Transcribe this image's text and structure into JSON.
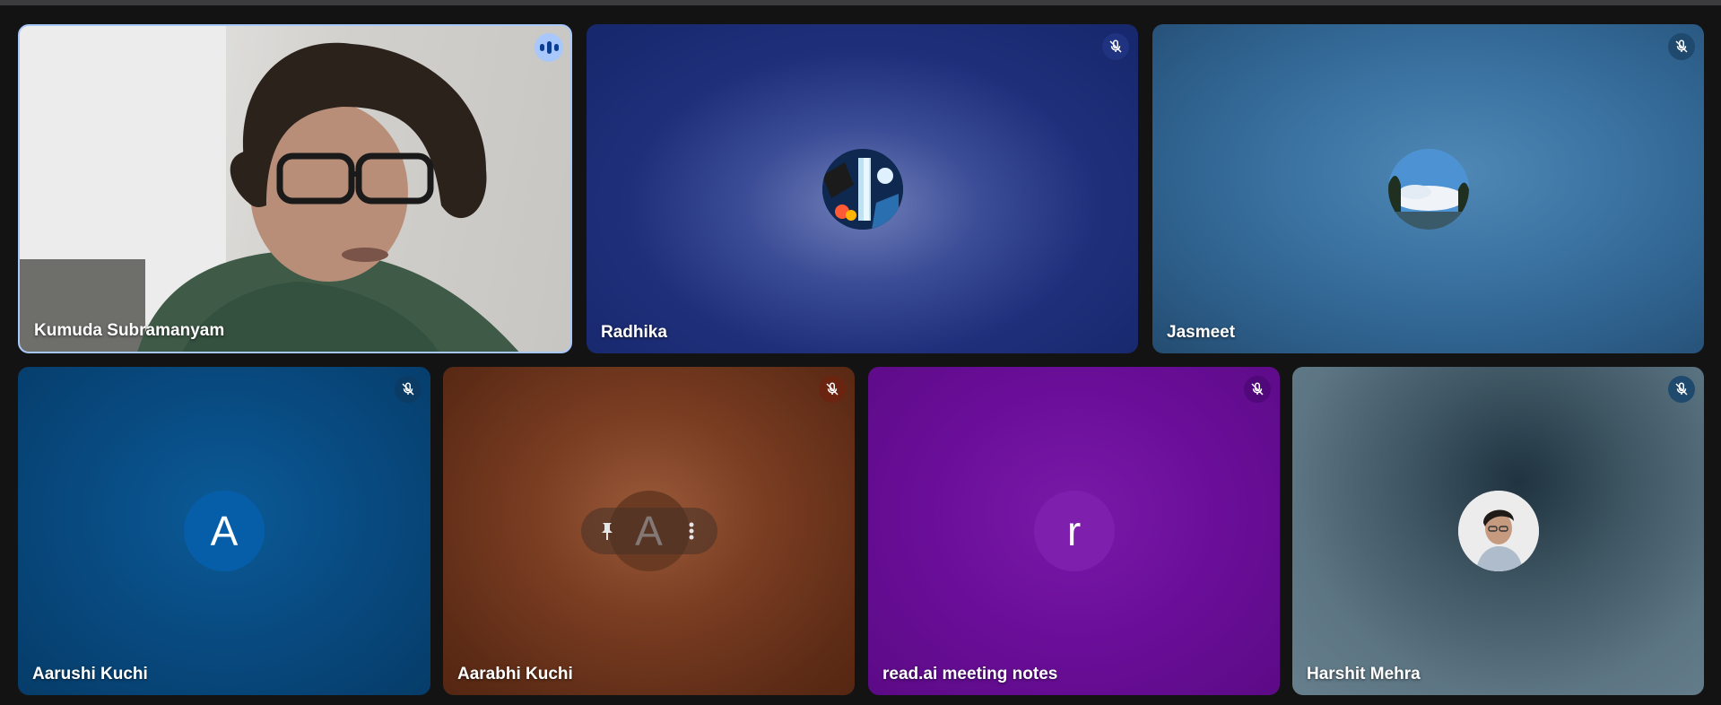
{
  "participants": [
    {
      "name": "Kumuda Subramanyam",
      "state": "speaking",
      "video": "camera"
    },
    {
      "name": "Radhika",
      "state": "muted",
      "avatar": "waterfall-photo-avatar"
    },
    {
      "name": "Jasmeet",
      "state": "muted",
      "avatar": "sky-photo-avatar"
    },
    {
      "name": "Aarushi Kuchi",
      "state": "muted",
      "avatar_letter": "A"
    },
    {
      "name": "Aarabhi Kuchi",
      "state": "muted",
      "avatar_letter": "A"
    },
    {
      "name": "read.ai meeting notes",
      "state": "muted",
      "avatar_letter": "r"
    },
    {
      "name": "Harshit Mehra",
      "state": "muted",
      "avatar": "portrait-photo-avatar"
    }
  ],
  "colors": {
    "accent": "#a8c7fa",
    "background": "#131314"
  },
  "icons": {
    "muted": "mic-off-icon",
    "speaking": "audio-level-icon",
    "pin": "pin-icon",
    "more": "more-vert-icon"
  }
}
